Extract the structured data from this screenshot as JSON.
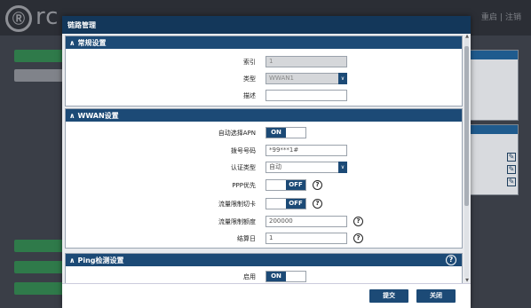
{
  "background": {
    "logo_text": "rc",
    "top_right": [
      "重启",
      "注销"
    ]
  },
  "modal": {
    "title": "链路管理",
    "sections": {
      "general": {
        "title": "常规设置",
        "index_label": "索引",
        "index_value": "1",
        "type_label": "类型",
        "type_value": "WWAN1",
        "desc_label": "描述",
        "desc_value": ""
      },
      "wwan": {
        "title": "WWAN设置",
        "apn_label": "自动选择APN",
        "apn_state": "ON",
        "dial_label": "拨号号码",
        "dial_value": "*99***1#",
        "auth_label": "认证类型",
        "auth_value": "自动",
        "ppp_label": "PPP优先",
        "ppp_state": "OFF",
        "switch_label": "流量限制切卡",
        "switch_state": "OFF",
        "limit_label": "流量限制额度",
        "limit_value": "200000",
        "billing_label": "结算日",
        "billing_value": "1"
      },
      "ping": {
        "title": "Ping检测设置",
        "enable_label": "启用",
        "enable_state": "ON"
      }
    },
    "footer": {
      "submit_label": "提交",
      "close_label": "关闭"
    }
  }
}
